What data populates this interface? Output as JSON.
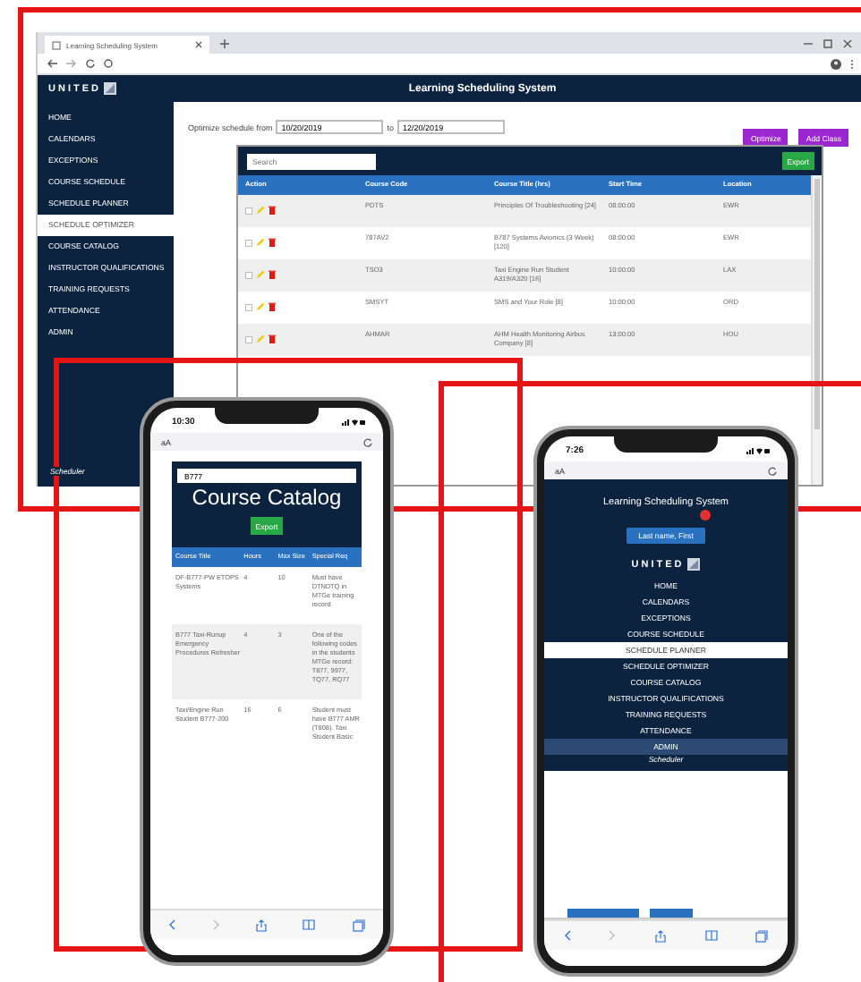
{
  "desktop": {
    "tab_title": "Learning Scheduling System",
    "logo": "UNITED",
    "app_title": "Learning Scheduling System",
    "nav": [
      {
        "label": "HOME",
        "selected": false
      },
      {
        "label": "CALENDARS",
        "selected": false
      },
      {
        "label": "EXCEPTIONS",
        "selected": false
      },
      {
        "label": "COURSE SCHEDULE",
        "selected": false
      },
      {
        "label": "SCHEDULE PLANNER",
        "selected": false
      },
      {
        "label": "SCHEDULE OPTIMIZER",
        "selected": true
      },
      {
        "label": "COURSE CATALOG",
        "selected": false
      },
      {
        "label": "INSTRUCTOR QUALIFICATIONS",
        "selected": false
      },
      {
        "label": "TRAINING REQUESTS",
        "selected": false
      },
      {
        "label": "ATTENDANCE",
        "selected": false
      },
      {
        "label": "ADMIN",
        "selected": false
      }
    ],
    "footer": "Scheduler",
    "optimize_label": "Optimize schedule from",
    "from": "10/20/2019",
    "to_label": "to",
    "to": "12/20/2019",
    "buttons": [
      "Optimize",
      "Add Class"
    ],
    "search_placeholder": "Search",
    "export": "Export",
    "columns": [
      "Action",
      "Course Code",
      "Course Title (hrs)",
      "Start Time",
      "Location"
    ],
    "rows": [
      {
        "checked": false,
        "code": "PDTS",
        "title": "Principles Of Troubleshooting [24]",
        "start": "08:00:00",
        "location": "EWR"
      },
      {
        "checked": false,
        "code": "787AV2",
        "title": "B787 Systems Avionics (3 Week) [120]",
        "start": "08:00:00",
        "location": "EWR"
      },
      {
        "checked": false,
        "code": "TSO3",
        "title": "Taxi Engine Run Student A319/A320 [16]",
        "start": "10:00:00",
        "location": "LAX"
      },
      {
        "checked": false,
        "code": "SMSYT",
        "title": "SMS and Your Role [8]",
        "start": "10:00:00",
        "location": "ORD"
      },
      {
        "checked": false,
        "code": "AHMAR",
        "title": "AHM Health Monitoring Airbus Company [8]",
        "start": "13:00:00",
        "location": "HOU"
      }
    ]
  },
  "phone_catalog": {
    "time": "10:30",
    "text_size": "aA",
    "search_value": "B777",
    "title": "Course Catalog",
    "export": "Export",
    "columns": [
      "Course Title",
      "Hours",
      "Max Size",
      "Special Req"
    ],
    "rows": [
      {
        "title": "DF-B777-PW ETOPS Systems",
        "hours": "4",
        "max_size": "10",
        "special_req": "Must have DTNDTQ in MTGe training record"
      },
      {
        "title": "B777 Taxi-Runup Emergency Procedures Refresher",
        "hours": "4",
        "max_size": "3",
        "special_req": "One of the following codes in the students MTGe record: T877, 9977, TQ77, RQ77"
      },
      {
        "title": "Taxi/Engine Run Student B777-200",
        "hours": "16",
        "max_size": "6",
        "special_req": "Student must have B777 AMR (T808). Taxi Student Basic"
      }
    ]
  },
  "phone_menu": {
    "time": "7:26",
    "text_size": "aA",
    "app_title": "Learning Scheduling System",
    "user": "Last name, First",
    "logo": "UNITED",
    "nav": [
      {
        "label": "HOME",
        "selected": false,
        "highlighted": false
      },
      {
        "label": "CALENDARS",
        "selected": false,
        "highlighted": false
      },
      {
        "label": "EXCEPTIONS",
        "selected": false,
        "highlighted": false
      },
      {
        "label": "COURSE SCHEDULE",
        "selected": false,
        "highlighted": false
      },
      {
        "label": "SCHEDULE PLANNER",
        "selected": true,
        "highlighted": false
      },
      {
        "label": "SCHEDULE OPTIMIZER",
        "selected": false,
        "highlighted": false
      },
      {
        "label": "COURSE CATALOG",
        "selected": false,
        "highlighted": false
      },
      {
        "label": "INSTRUCTOR QUALIFICATIONS",
        "selected": false,
        "highlighted": false
      },
      {
        "label": "TRAINING REQUESTS",
        "selected": false,
        "highlighted": false
      },
      {
        "label": "ATTENDANCE",
        "selected": false,
        "highlighted": false
      },
      {
        "label": "ADMIN",
        "selected": false,
        "highlighted": true
      }
    ],
    "footer": "Scheduler"
  }
}
